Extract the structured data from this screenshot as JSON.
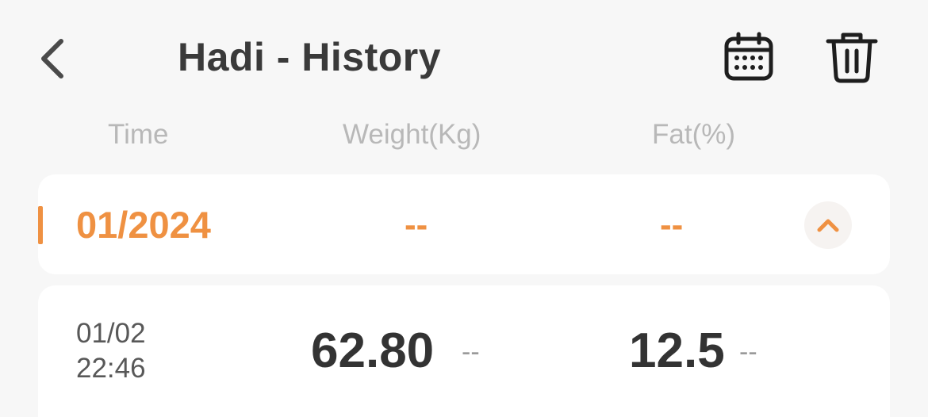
{
  "header": {
    "title": "Hadi - History",
    "back_icon": "chevron-left-icon",
    "calendar_icon": "calendar-icon",
    "delete_icon": "trash-icon"
  },
  "columns": {
    "time": "Time",
    "weight": "Weight(Kg)",
    "fat": "Fat(%)"
  },
  "month_group": {
    "label": "01/2024",
    "weight": "--",
    "fat": "--",
    "collapse_icon": "chevron-up-icon",
    "expanded": true
  },
  "records": [
    {
      "date": "01/02",
      "time": "22:46",
      "weight": "62.80",
      "weight_change": "--",
      "fat": "12.5",
      "fat_change": "--"
    }
  ],
  "colors": {
    "accent": "#ef9142",
    "title": "#3a3a3a",
    "muted": "#b8b8b8",
    "background": "#f7f7f7",
    "card": "#ffffff"
  }
}
